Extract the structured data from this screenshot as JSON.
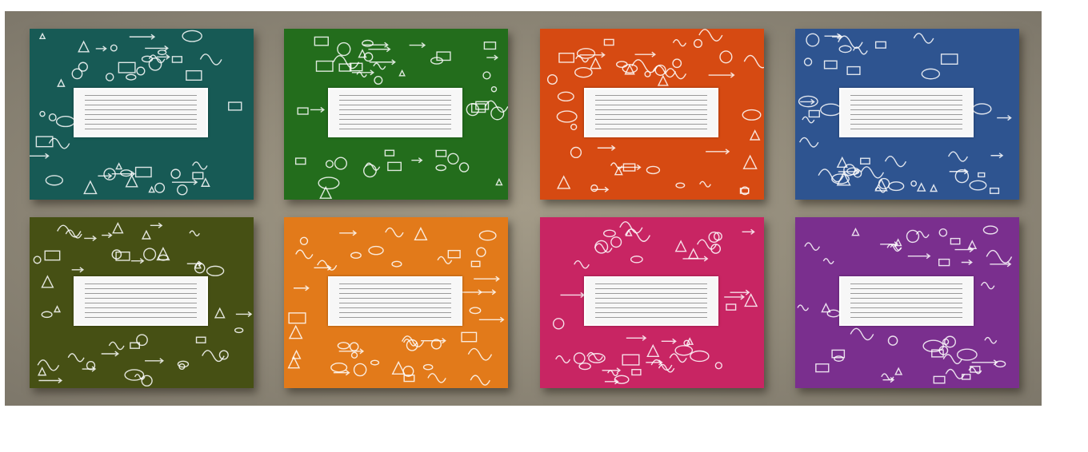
{
  "covers": [
    {
      "color": "#175a55"
    },
    {
      "color": "#236d1c"
    },
    {
      "color": "#d64a12"
    },
    {
      "color": "#2e5490"
    },
    {
      "color": "#465014"
    },
    {
      "color": "#e27a1a"
    },
    {
      "color": "#c82563"
    },
    {
      "color": "#7a2f8e"
    }
  ],
  "board_color": "#8f8878",
  "label_lines": 8
}
